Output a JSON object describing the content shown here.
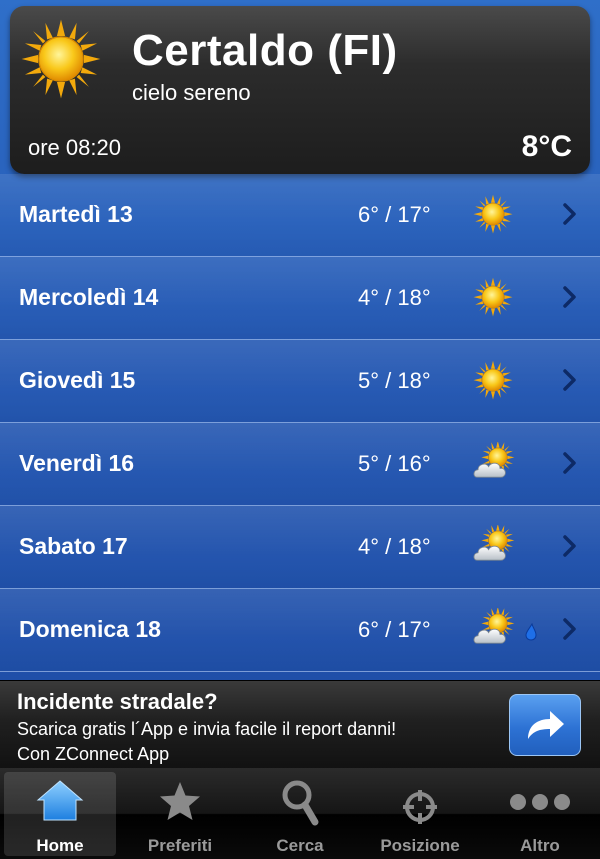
{
  "current": {
    "city": "Certaldo (FI)",
    "condition": "cielo sereno",
    "time": "ore 08:20",
    "temperature": "8°C",
    "icon": "sun-icon"
  },
  "forecast": [
    {
      "day": "Martedì 13",
      "range": "6° / 17°",
      "icon": "sun-icon",
      "rain": false
    },
    {
      "day": "Mercoledì 14",
      "range": "4° / 18°",
      "icon": "sun-icon",
      "rain": false
    },
    {
      "day": "Giovedì 15",
      "range": "5° / 18°",
      "icon": "sun-icon",
      "rain": false
    },
    {
      "day": "Venerdì 16",
      "range": "5° / 16°",
      "icon": "sun-cloud-icon",
      "rain": false
    },
    {
      "day": "Sabato 17",
      "range": "4° / 18°",
      "icon": "sun-cloud-icon",
      "rain": false
    },
    {
      "day": "Domenica 18",
      "range": "6° / 17°",
      "icon": "sun-cloud-icon",
      "rain": true
    }
  ],
  "ad": {
    "title": "Incidente stradale?",
    "line1": "Scarica gratis l´App e invia facile il report danni!",
    "line2": "Con ZConnect App",
    "button_icon": "share-arrow-icon"
  },
  "tabs": [
    {
      "label": "Home",
      "icon": "home-icon",
      "active": true
    },
    {
      "label": "Preferiti",
      "icon": "star-icon",
      "active": false
    },
    {
      "label": "Cerca",
      "icon": "magnifier-icon",
      "active": false
    },
    {
      "label": "Posizione",
      "icon": "crosshair-icon",
      "active": false
    },
    {
      "label": "Altro",
      "icon": "more-dots-icon",
      "active": false
    }
  ],
  "colors": {
    "background": "#2458b3",
    "header_bg": "#2c2c2c",
    "sun": "#f7c51a",
    "ad_button": "#2d72d4"
  }
}
